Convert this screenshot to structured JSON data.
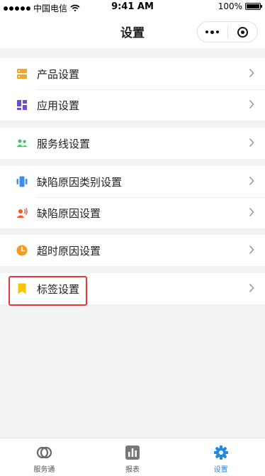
{
  "status_bar": {
    "carrier": "中国电信",
    "time": "9:41 AM",
    "battery": "100%"
  },
  "nav": {
    "title": "设置"
  },
  "settings": [
    {
      "label": "产品设置",
      "icon": "server-icon",
      "color": "#f4a52b"
    },
    {
      "label": "应用设置",
      "icon": "grid-icon",
      "color": "#6f4fd0"
    },
    {
      "label": "服务线设置",
      "icon": "users-icon",
      "color": "#3ec76a"
    },
    {
      "label": "缺陷原因类别设置",
      "icon": "phone-icon",
      "color": "#3e8ef0"
    },
    {
      "label": "缺陷原因设置",
      "icon": "person-voice-icon",
      "color": "#f2592f"
    },
    {
      "label": "超时原因设置",
      "icon": "clock-icon",
      "color": "#f59c1f"
    },
    {
      "label": "标签设置",
      "icon": "bookmark-icon",
      "color": "#f7c400"
    }
  ],
  "tabs": [
    {
      "label": "服务通",
      "icon": "service-icon",
      "active": false
    },
    {
      "label": "报表",
      "icon": "report-icon",
      "active": false
    },
    {
      "label": "设置",
      "icon": "settings-gear-icon",
      "active": true
    }
  ],
  "colors": {
    "accent": "#1e88e5",
    "highlight": "#e53935"
  }
}
